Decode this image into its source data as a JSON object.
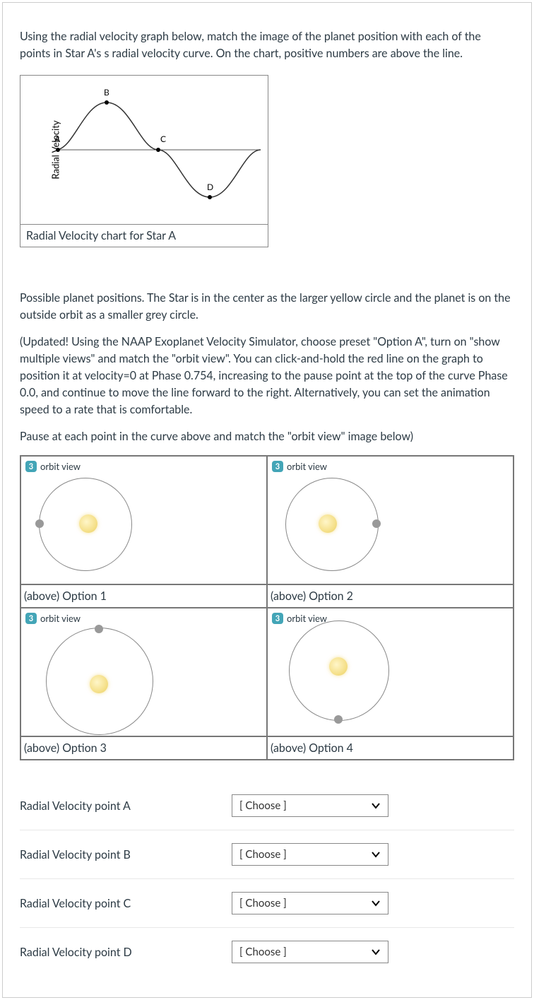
{
  "intro": "Using the radial velocity graph below, match the image of the planet position with each of the points in Star A's s radial velocity curve.   On the chart, positive numbers are above the line.",
  "chart_caption": "Radial Velocity chart for Star A",
  "ylabel": "Radial Velocity",
  "points": {
    "A": "A",
    "B": "B",
    "C": "C",
    "D": "D"
  },
  "chart_data": {
    "type": "line",
    "title": "Radial Velocity chart for Star A",
    "xlabel": "",
    "ylabel": "Radial Velocity",
    "ylim": [
      -1,
      1
    ],
    "xlim": [
      0,
      1
    ],
    "series": [
      {
        "name": "Radial Velocity",
        "x": [
          0.0,
          0.05,
          0.1,
          0.15,
          0.2,
          0.25,
          0.3,
          0.35,
          0.4,
          0.45,
          0.5,
          0.55,
          0.6,
          0.65,
          0.7,
          0.75,
          0.8,
          0.85,
          0.9,
          0.95,
          1.0
        ],
        "values": [
          0.0,
          0.31,
          0.59,
          0.81,
          0.95,
          1.0,
          0.95,
          0.81,
          0.59,
          0.31,
          0.0,
          -0.31,
          -0.59,
          -0.81,
          -0.95,
          -1.0,
          -0.95,
          -0.81,
          -0.59,
          -0.31,
          0.0
        ]
      }
    ],
    "annotations": [
      {
        "label": "A",
        "x": 0.0,
        "y": 0.0
      },
      {
        "label": "B",
        "x": 0.25,
        "y": 1.0
      },
      {
        "label": "C",
        "x": 0.5,
        "y": 0.0
      },
      {
        "label": "D",
        "x": 0.75,
        "y": -1.0
      }
    ]
  },
  "para2": "Possible planet positions.  The Star is in the center as the larger yellow circle and the planet is on the outside orbit as a smaller grey circle.",
  "para3": "(Updated!  Using the NAAP Exoplanet Velocity Simulator, choose preset \"Option A\", turn on \"show multiple views\" and match the \"orbit view\".  You can click-and-hold the red line on the graph to position it at velocity=0 at Phase 0.754, increasing to the pause point at the top of the curve Phase 0.0, and continue to move the line forward to the right.  Alternatively, you can set the animation speed to a rate that is comfortable.",
  "para4": "Pause at each point in the curve above and match the \"orbit view\" image below)",
  "orbit": {
    "badge": "3",
    "header": "orbit view",
    "options": {
      "o1": "(above) Option 1",
      "o2": "(above) Option 2",
      "o3": "(above) Option 3",
      "o4": "(above) Option 4"
    }
  },
  "match": {
    "rows": [
      {
        "label": "Radial Velocity point A"
      },
      {
        "label": "Radial Velocity point B"
      },
      {
        "label": "Radial Velocity point C"
      },
      {
        "label": "Radial Velocity point D"
      }
    ],
    "choose": "[ Choose ]"
  }
}
